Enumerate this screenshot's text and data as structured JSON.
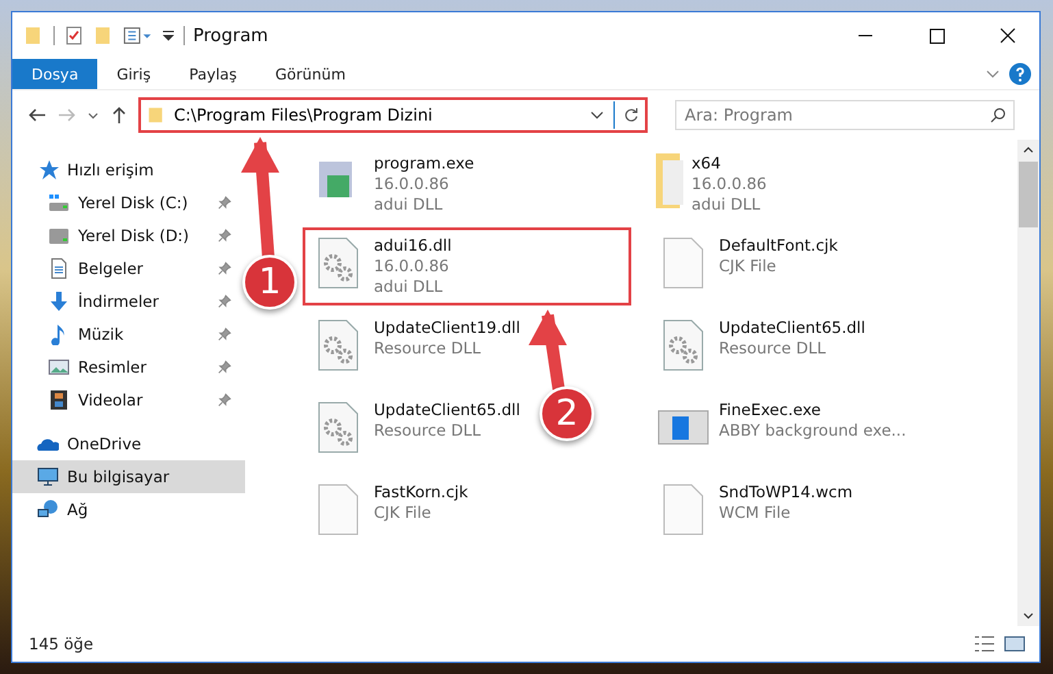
{
  "window": {
    "title": "Program"
  },
  "ribbon_tabs": [
    {
      "label": "Dosya",
      "selected": true
    },
    {
      "label": "Giriş",
      "selected": false
    },
    {
      "label": "Paylaş",
      "selected": false
    },
    {
      "label": "Görünüm",
      "selected": false
    }
  ],
  "address_bar": {
    "path": "C:\\Program Files\\Program Dizini",
    "highlighted": true
  },
  "search": {
    "placeholder": "Ara: Program"
  },
  "sidebar": {
    "items": [
      {
        "label": "Hızlı erişim",
        "selected": false,
        "children": [
          {
            "label": "Yerel Disk (C:)",
            "pinned": true,
            "selected": false
          },
          {
            "label": "Yerel Disk (D:)",
            "pinned": true,
            "selected": false
          },
          {
            "label": "Belgeler",
            "pinned": true,
            "selected": false
          },
          {
            "label": "İndirmeler",
            "pinned": true,
            "selected": false
          },
          {
            "label": "Müzik",
            "pinned": true,
            "selected": false
          },
          {
            "label": "Resimler",
            "pinned": true,
            "selected": false
          },
          {
            "label": "Videolar",
            "pinned": true,
            "selected": false
          }
        ]
      },
      {
        "label": "OneDrive",
        "selected": false
      },
      {
        "label": "Bu bilgisayar",
        "selected": true
      },
      {
        "label": "Ağ",
        "selected": false
      }
    ]
  },
  "files": [
    {
      "name": "program.exe",
      "details": [
        "16.0.0.86",
        "adui DLL"
      ],
      "kind": "exe",
      "highlighted": false
    },
    {
      "name": "x64",
      "details": [
        "16.0.0.86",
        "adui DLL"
      ],
      "kind": "folder",
      "highlighted": false
    },
    {
      "name": "adui16.dll",
      "details": [
        "16.0.0.86",
        "adui DLL"
      ],
      "kind": "dll",
      "highlighted": true
    },
    {
      "name": "DefaultFont.cjk",
      "details": [
        "CJK File"
      ],
      "kind": "file",
      "highlighted": false
    },
    {
      "name": "UpdateClient19.dll",
      "details": [
        "Resource DLL"
      ],
      "kind": "dll",
      "highlighted": false
    },
    {
      "name": "UpdateClient65.dll",
      "details": [
        "Resource DLL"
      ],
      "kind": "dll",
      "highlighted": false
    },
    {
      "name": "UpdateClient65.dll",
      "details": [
        "Resource DLL"
      ],
      "kind": "dll",
      "highlighted": false
    },
    {
      "name": "FineExec.exe",
      "details": [
        "ABBY background exe..."
      ],
      "kind": "app",
      "highlighted": false
    },
    {
      "name": "FastKorn.cjk",
      "details": [
        "CJK File"
      ],
      "kind": "file",
      "highlighted": false
    },
    {
      "name": "SndToWP14.wcm",
      "details": [
        "WCM File"
      ],
      "kind": "file",
      "highlighted": false
    }
  ],
  "annotations": [
    {
      "label": "1"
    },
    {
      "label": "2"
    }
  ],
  "status_bar": {
    "item_count": "145 öğe"
  }
}
